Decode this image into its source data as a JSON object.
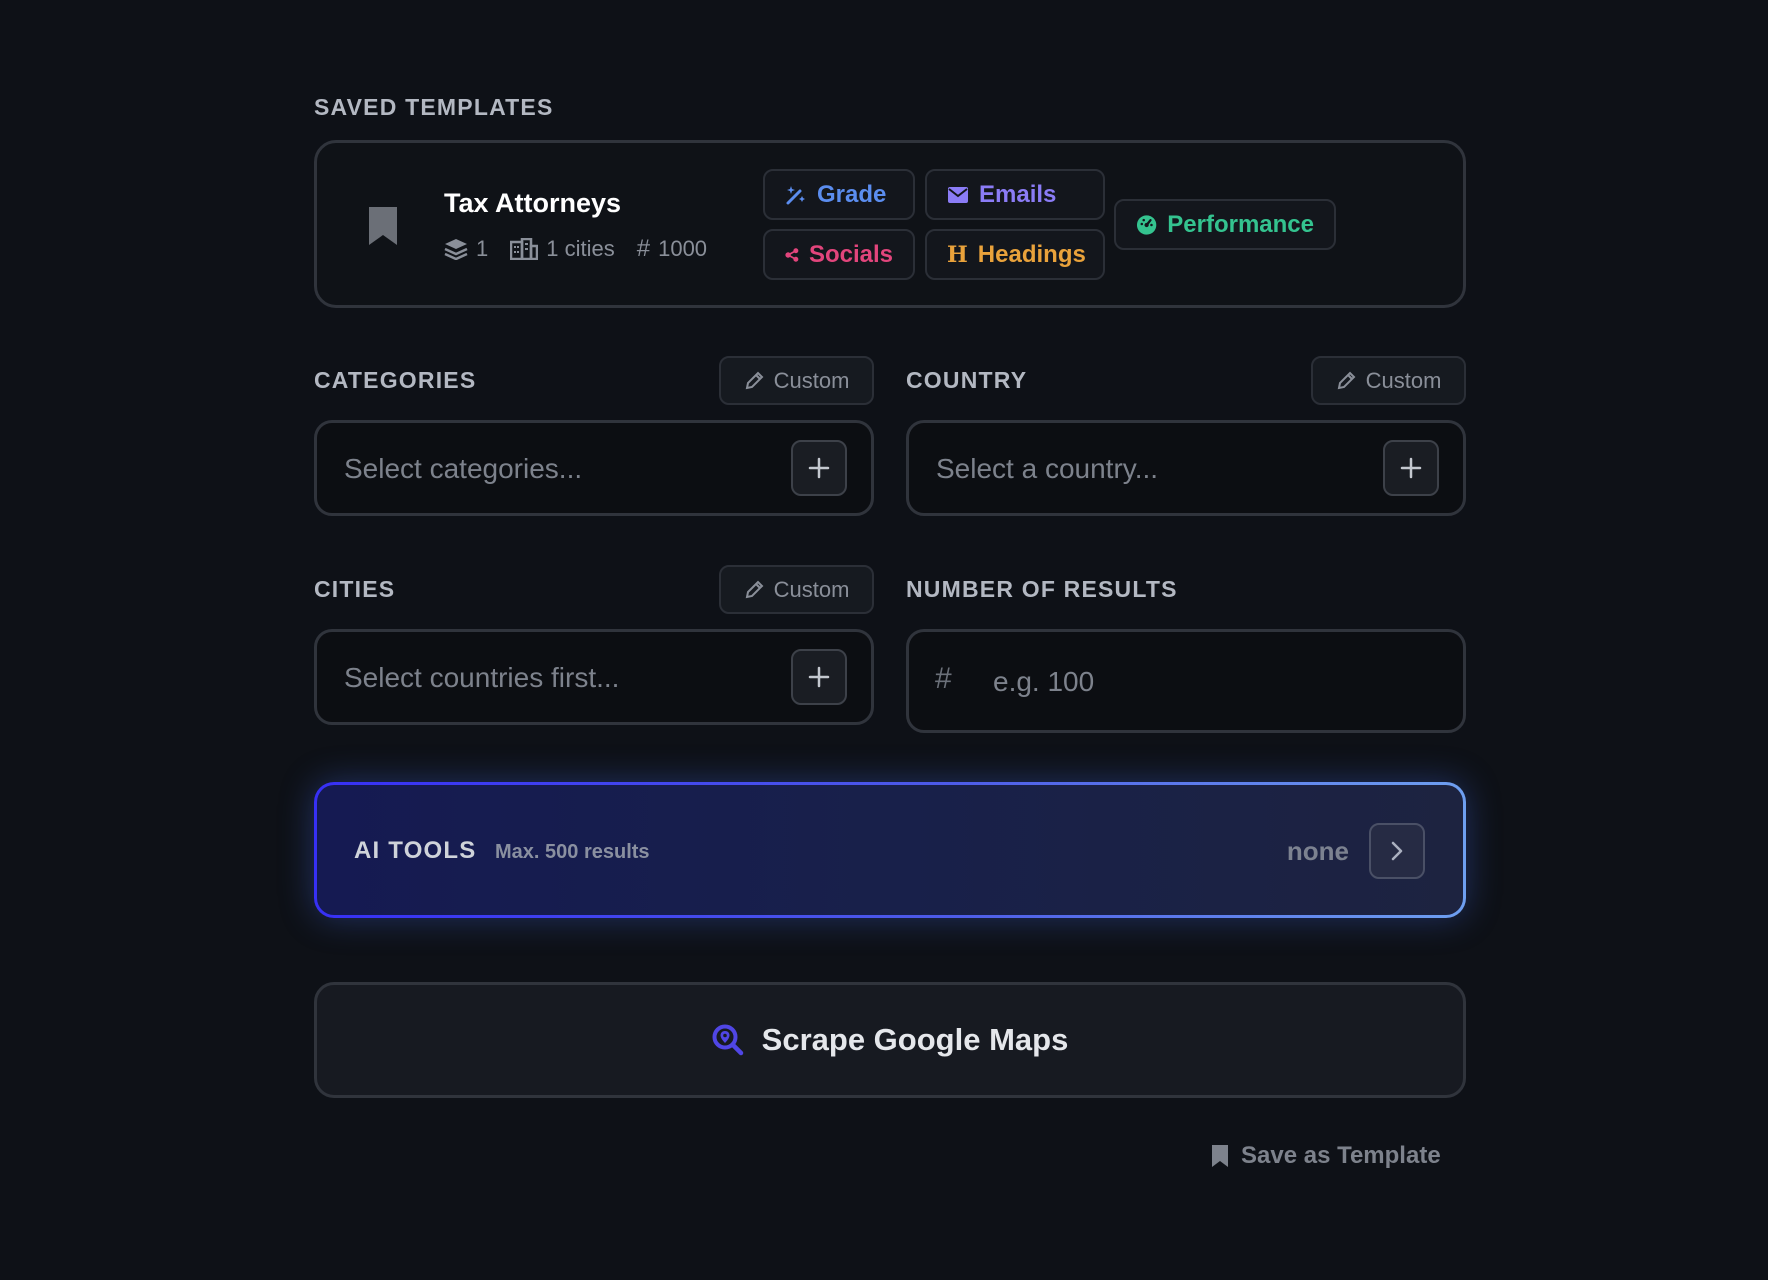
{
  "saved_templates": {
    "title": "SAVED TEMPLATES",
    "template": {
      "name": "Tax Attorneys",
      "categories_count": "1",
      "cities_label": "1 cities",
      "results_count": "1000",
      "tags": [
        {
          "label": "Grade",
          "color": "#5b8def",
          "icon": "magic-wand-icon"
        },
        {
          "label": "Emails",
          "color": "#8b7cf6",
          "icon": "envelope-icon"
        },
        {
          "label": "Socials",
          "color": "#e2457c",
          "icon": "share-icon"
        },
        {
          "label": "Headings",
          "color": "#e9a23b",
          "icon": "heading-icon"
        },
        {
          "label": "Performance",
          "color": "#34c38f",
          "icon": "gauge-icon"
        }
      ]
    }
  },
  "categories": {
    "label": "CATEGORIES",
    "custom_label": "Custom",
    "placeholder": "Select categories..."
  },
  "country": {
    "label": "COUNTRY",
    "custom_label": "Custom",
    "placeholder": "Select a country..."
  },
  "cities": {
    "label": "CITIES",
    "custom_label": "Custom",
    "placeholder": "Select countries first..."
  },
  "number_of_results": {
    "label": "NUMBER OF RESULTS",
    "prefix": "#",
    "placeholder": "e.g. 100"
  },
  "ai_tools": {
    "title": "AI TOOLS",
    "subtitle": "Max. 500 results",
    "value": "none"
  },
  "actions": {
    "scrape_label": "Scrape Google Maps",
    "save_template_label": "Save as Template"
  },
  "colors": {
    "background": "#0e1117",
    "accent": "#4f46e5",
    "border": "#30343c"
  }
}
